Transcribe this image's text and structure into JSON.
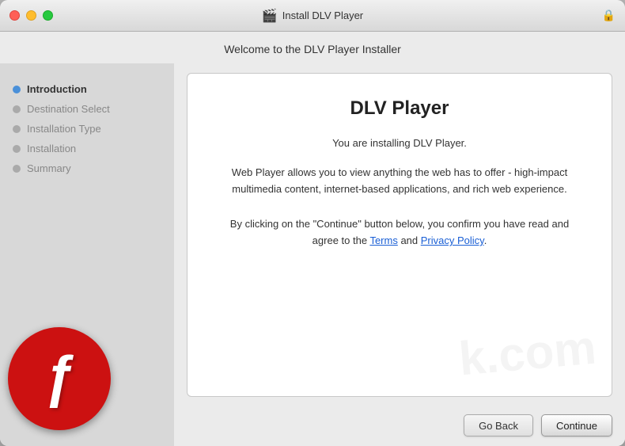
{
  "window": {
    "title": "Install DLV Player",
    "titlebar_icon": "🎬",
    "lock_icon": "🔒"
  },
  "header": {
    "text": "Welcome to the DLV Player Installer"
  },
  "sidebar": {
    "items": [
      {
        "label": "Introduction",
        "active": true
      },
      {
        "label": "Destination Select",
        "active": false
      },
      {
        "label": "Installation Type",
        "active": false
      },
      {
        "label": "Installation",
        "active": false
      },
      {
        "label": "Summary",
        "active": false
      }
    ]
  },
  "content": {
    "product_title": "DLV Player",
    "intro_text": "You are installing DLV Player.",
    "description_text": "Web Player allows you to view anything the web has to offer - high-impact multimedia content, internet-based applications, and rich web experience.",
    "agreement_prefix": "By clicking on the \"Continue\" button below, you confirm you have read and agree to the ",
    "terms_link": "Terms",
    "agreement_middle": " and ",
    "privacy_link": "Privacy Policy",
    "agreement_suffix": ".",
    "watermark_text": "k.com"
  },
  "footer": {
    "back_label": "Go Back",
    "continue_label": "Continue"
  }
}
